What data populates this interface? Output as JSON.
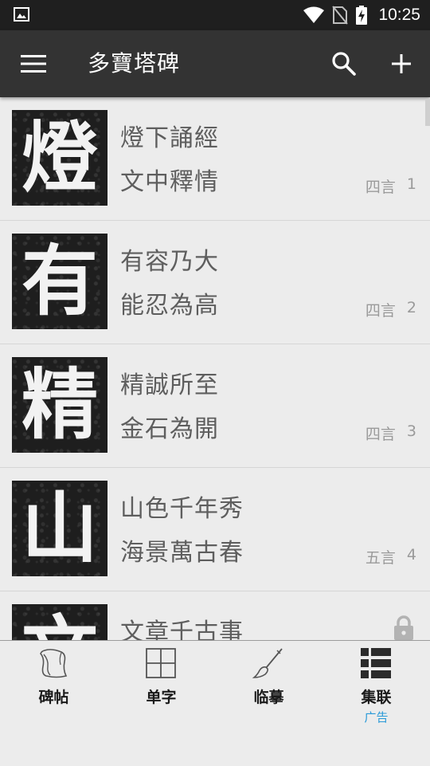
{
  "status_bar": {
    "time": "10:25",
    "icons": [
      "image-notification-icon",
      "wifi-icon",
      "no-sim-icon",
      "battery-charging-icon"
    ]
  },
  "app_bar": {
    "title": "多寶塔碑",
    "icons": [
      "menu-icon",
      "search-icon",
      "add-icon"
    ]
  },
  "list": {
    "items": [
      {
        "glyph": "燈",
        "line1": "燈下誦經",
        "line2": "文中釋情",
        "type": "四言",
        "index": "1"
      },
      {
        "glyph": "有",
        "line1": "有容乃大",
        "line2": "能忍為高",
        "type": "四言",
        "index": "2"
      },
      {
        "glyph": "精",
        "line1": "精誠所至",
        "line2": "金石為開",
        "type": "四言",
        "index": "3"
      },
      {
        "glyph": "山",
        "line1": "山色千年秀",
        "line2": "海景萬古春",
        "type": "五言",
        "index": "4"
      },
      {
        "glyph": "文",
        "line1": "文章千古事",
        "line2": "",
        "type": "",
        "index": "",
        "locked": true
      }
    ]
  },
  "bottom_nav": {
    "tabs": [
      {
        "label": "碑帖",
        "icon": "scroll-icon"
      },
      {
        "label": "单字",
        "icon": "grid-icon"
      },
      {
        "label": "临摹",
        "icon": "brush-icon"
      },
      {
        "label": "集联",
        "icon": "list-grid-icon",
        "badge": "广告"
      }
    ]
  },
  "colors": {
    "status_bar": "#1f1f1f",
    "app_bar": "#333333",
    "background": "#ececec",
    "ad_badge": "#2a9ad8"
  }
}
